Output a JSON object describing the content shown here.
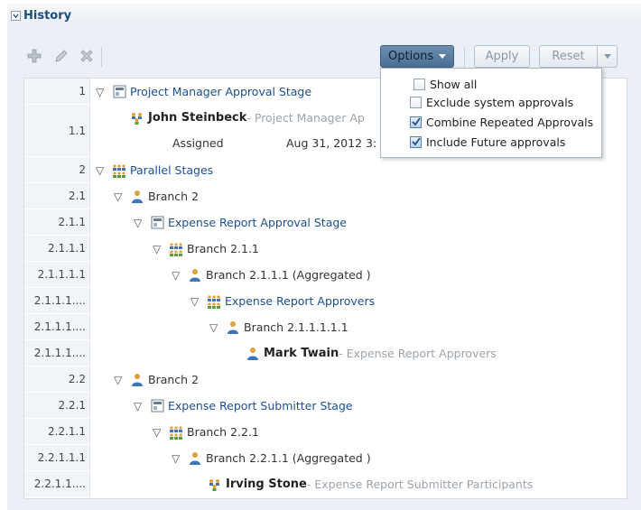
{
  "panel": {
    "title": "History"
  },
  "toolbar": {
    "options_label": "Options",
    "apply_label": "Apply",
    "reset_label": "Reset"
  },
  "options_menu": {
    "items": [
      {
        "label": "Show all",
        "checked": false
      },
      {
        "label": "Exclude system approvals",
        "checked": false
      },
      {
        "label": "Combine Repeated Approvals",
        "checked": true
      },
      {
        "label": "Include Future approvals",
        "checked": true
      }
    ]
  },
  "tree": {
    "rows": [
      {
        "num": "1",
        "label": "Project Manager Approval Stage",
        "icon": "stage-icon"
      },
      {
        "num": "1.1",
        "name": "John Steinbeck",
        "sub": " - Project Manager Ap",
        "status": "Assigned",
        "date": "Aug 31, 2012 3:",
        "icon": "participant-group-icon"
      },
      {
        "num": "2",
        "label": "Parallel Stages",
        "icon": "group-icon"
      },
      {
        "num": "2.1",
        "label": "Branch 2",
        "icon": "user-icon"
      },
      {
        "num": "2.1.1",
        "label": "Expense Report Approval Stage",
        "icon": "stage-icon"
      },
      {
        "num": "2.1.1.1",
        "label": "Branch 2.1.1",
        "icon": "group-icon"
      },
      {
        "num": "2.1.1.1.1",
        "label": "Branch 2.1.1.1 (Aggregated )",
        "icon": "user-icon"
      },
      {
        "num": "2.1.1.1....",
        "label": "Expense Report Approvers",
        "icon": "group-icon"
      },
      {
        "num": "2.1.1.1....",
        "label": "Branch 2.1.1.1.1.1",
        "icon": "user-icon"
      },
      {
        "num": "2.1.1.1....",
        "name": "Mark Twain",
        "sub": " - Expense Report Approvers",
        "icon": "user-icon"
      },
      {
        "num": "2.2",
        "label": "Branch 2",
        "icon": "user-icon"
      },
      {
        "num": "2.2.1",
        "label": "Expense Report Submitter Stage",
        "icon": "stage-icon"
      },
      {
        "num": "2.2.1.1",
        "label": "Branch 2.2.1",
        "icon": "group-icon"
      },
      {
        "num": "2.2.1.1.1",
        "label": "Branch 2.2.1.1 (Aggregated )",
        "icon": "user-icon"
      },
      {
        "num": "2.2.1.1....",
        "name": "Irving Stone",
        "sub": " - Expense Report Submitter Participants",
        "icon": "participant-group-icon"
      }
    ]
  }
}
